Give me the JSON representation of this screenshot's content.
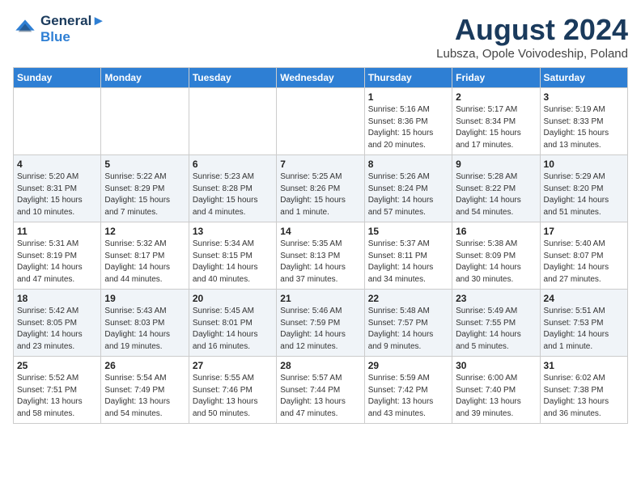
{
  "header": {
    "logo_line1": "General",
    "logo_line2": "Blue",
    "month": "August 2024",
    "location": "Lubsza, Opole Voivodeship, Poland"
  },
  "weekdays": [
    "Sunday",
    "Monday",
    "Tuesday",
    "Wednesday",
    "Thursday",
    "Friday",
    "Saturday"
  ],
  "weeks": [
    [
      {
        "day": "",
        "info": ""
      },
      {
        "day": "",
        "info": ""
      },
      {
        "day": "",
        "info": ""
      },
      {
        "day": "",
        "info": ""
      },
      {
        "day": "1",
        "info": "Sunrise: 5:16 AM\nSunset: 8:36 PM\nDaylight: 15 hours\nand 20 minutes."
      },
      {
        "day": "2",
        "info": "Sunrise: 5:17 AM\nSunset: 8:34 PM\nDaylight: 15 hours\nand 17 minutes."
      },
      {
        "day": "3",
        "info": "Sunrise: 5:19 AM\nSunset: 8:33 PM\nDaylight: 15 hours\nand 13 minutes."
      }
    ],
    [
      {
        "day": "4",
        "info": "Sunrise: 5:20 AM\nSunset: 8:31 PM\nDaylight: 15 hours\nand 10 minutes."
      },
      {
        "day": "5",
        "info": "Sunrise: 5:22 AM\nSunset: 8:29 PM\nDaylight: 15 hours\nand 7 minutes."
      },
      {
        "day": "6",
        "info": "Sunrise: 5:23 AM\nSunset: 8:28 PM\nDaylight: 15 hours\nand 4 minutes."
      },
      {
        "day": "7",
        "info": "Sunrise: 5:25 AM\nSunset: 8:26 PM\nDaylight: 15 hours\nand 1 minute."
      },
      {
        "day": "8",
        "info": "Sunrise: 5:26 AM\nSunset: 8:24 PM\nDaylight: 14 hours\nand 57 minutes."
      },
      {
        "day": "9",
        "info": "Sunrise: 5:28 AM\nSunset: 8:22 PM\nDaylight: 14 hours\nand 54 minutes."
      },
      {
        "day": "10",
        "info": "Sunrise: 5:29 AM\nSunset: 8:20 PM\nDaylight: 14 hours\nand 51 minutes."
      }
    ],
    [
      {
        "day": "11",
        "info": "Sunrise: 5:31 AM\nSunset: 8:19 PM\nDaylight: 14 hours\nand 47 minutes."
      },
      {
        "day": "12",
        "info": "Sunrise: 5:32 AM\nSunset: 8:17 PM\nDaylight: 14 hours\nand 44 minutes."
      },
      {
        "day": "13",
        "info": "Sunrise: 5:34 AM\nSunset: 8:15 PM\nDaylight: 14 hours\nand 40 minutes."
      },
      {
        "day": "14",
        "info": "Sunrise: 5:35 AM\nSunset: 8:13 PM\nDaylight: 14 hours\nand 37 minutes."
      },
      {
        "day": "15",
        "info": "Sunrise: 5:37 AM\nSunset: 8:11 PM\nDaylight: 14 hours\nand 34 minutes."
      },
      {
        "day": "16",
        "info": "Sunrise: 5:38 AM\nSunset: 8:09 PM\nDaylight: 14 hours\nand 30 minutes."
      },
      {
        "day": "17",
        "info": "Sunrise: 5:40 AM\nSunset: 8:07 PM\nDaylight: 14 hours\nand 27 minutes."
      }
    ],
    [
      {
        "day": "18",
        "info": "Sunrise: 5:42 AM\nSunset: 8:05 PM\nDaylight: 14 hours\nand 23 minutes."
      },
      {
        "day": "19",
        "info": "Sunrise: 5:43 AM\nSunset: 8:03 PM\nDaylight: 14 hours\nand 19 minutes."
      },
      {
        "day": "20",
        "info": "Sunrise: 5:45 AM\nSunset: 8:01 PM\nDaylight: 14 hours\nand 16 minutes."
      },
      {
        "day": "21",
        "info": "Sunrise: 5:46 AM\nSunset: 7:59 PM\nDaylight: 14 hours\nand 12 minutes."
      },
      {
        "day": "22",
        "info": "Sunrise: 5:48 AM\nSunset: 7:57 PM\nDaylight: 14 hours\nand 9 minutes."
      },
      {
        "day": "23",
        "info": "Sunrise: 5:49 AM\nSunset: 7:55 PM\nDaylight: 14 hours\nand 5 minutes."
      },
      {
        "day": "24",
        "info": "Sunrise: 5:51 AM\nSunset: 7:53 PM\nDaylight: 14 hours\nand 1 minute."
      }
    ],
    [
      {
        "day": "25",
        "info": "Sunrise: 5:52 AM\nSunset: 7:51 PM\nDaylight: 13 hours\nand 58 minutes."
      },
      {
        "day": "26",
        "info": "Sunrise: 5:54 AM\nSunset: 7:49 PM\nDaylight: 13 hours\nand 54 minutes."
      },
      {
        "day": "27",
        "info": "Sunrise: 5:55 AM\nSunset: 7:46 PM\nDaylight: 13 hours\nand 50 minutes."
      },
      {
        "day": "28",
        "info": "Sunrise: 5:57 AM\nSunset: 7:44 PM\nDaylight: 13 hours\nand 47 minutes."
      },
      {
        "day": "29",
        "info": "Sunrise: 5:59 AM\nSunset: 7:42 PM\nDaylight: 13 hours\nand 43 minutes."
      },
      {
        "day": "30",
        "info": "Sunrise: 6:00 AM\nSunset: 7:40 PM\nDaylight: 13 hours\nand 39 minutes."
      },
      {
        "day": "31",
        "info": "Sunrise: 6:02 AM\nSunset: 7:38 PM\nDaylight: 13 hours\nand 36 minutes."
      }
    ]
  ]
}
